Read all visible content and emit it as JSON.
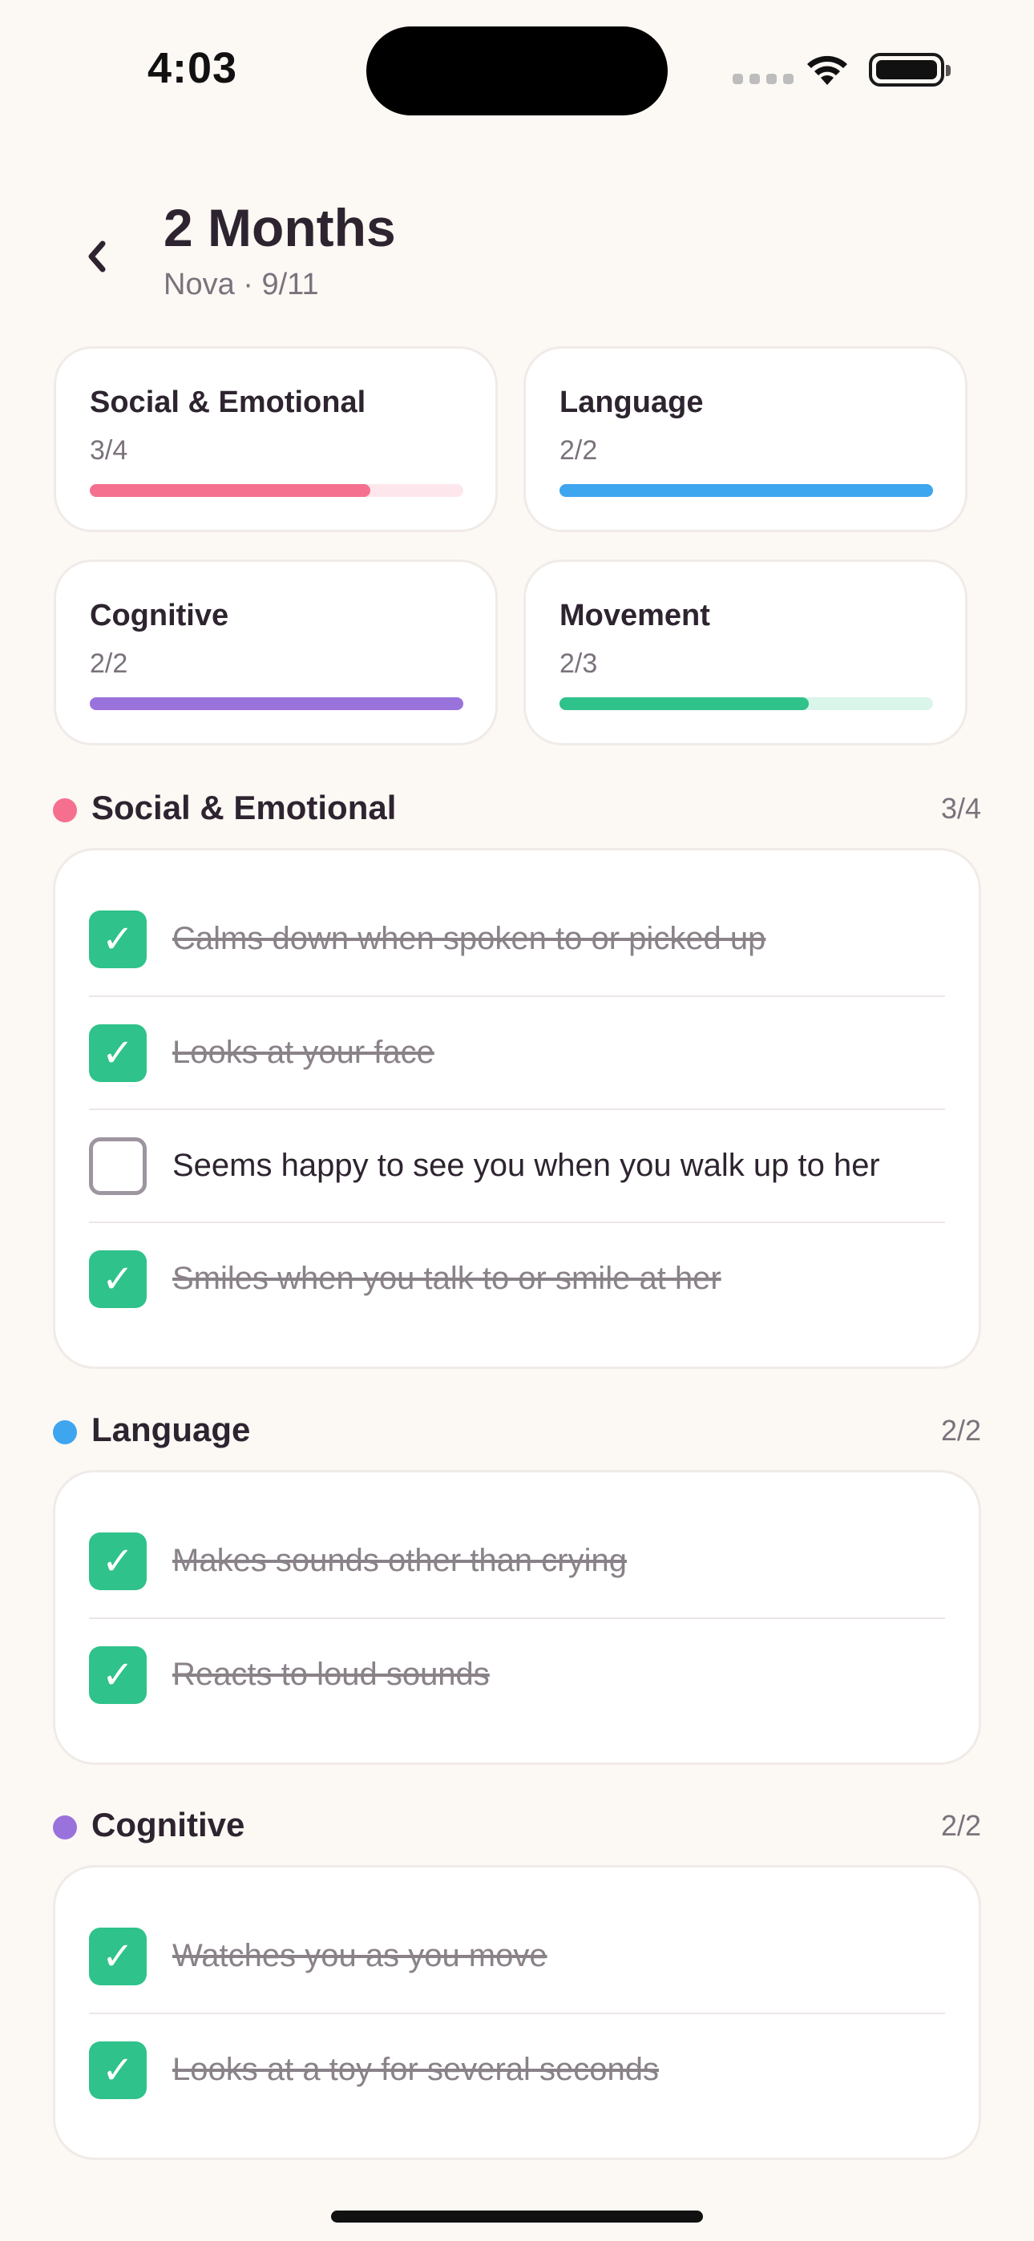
{
  "status_bar": {
    "time": "4:03"
  },
  "header": {
    "title": "2 Months",
    "subtitle": "Nova · 9/11"
  },
  "colors": {
    "social": "#f5708f",
    "social_track": "#fde6ec",
    "language": "#3ea5ef",
    "language_track": "#dcefff",
    "cognitive": "#9a72dc",
    "cognitive_track": "#ece4fa",
    "movement": "#2fc28a",
    "movement_track": "#daf5ea"
  },
  "summary": [
    {
      "title": "Social & Emotional",
      "count": "3/4",
      "progress": 0.75
    },
    {
      "title": "Language",
      "count": "2/2",
      "progress": 1.0
    },
    {
      "title": "Cognitive",
      "count": "2/2",
      "progress": 1.0
    },
    {
      "title": "Movement",
      "count": "2/3",
      "progress": 0.667
    }
  ],
  "sections": [
    {
      "title": "Social & Emotional",
      "count": "3/4",
      "items": [
        {
          "text": "Calms down when spoken to or picked up",
          "checked": true
        },
        {
          "text": "Looks at your face",
          "checked": true
        },
        {
          "text": "Seems happy to see you when you walk up to her",
          "checked": false
        },
        {
          "text": "Smiles when you talk to or smile at her",
          "checked": true
        }
      ]
    },
    {
      "title": "Language",
      "count": "2/2",
      "items": [
        {
          "text": "Makes sounds other than crying",
          "checked": true
        },
        {
          "text": "Reacts to loud sounds",
          "checked": true
        }
      ]
    },
    {
      "title": "Cognitive",
      "count": "2/2",
      "items": [
        {
          "text": "Watches you as you move",
          "checked": true
        },
        {
          "text": "Looks at a toy for several seconds",
          "checked": true
        }
      ]
    }
  ],
  "icons": {
    "back": "chevron-left-icon",
    "check": "checkmark-icon",
    "wifi": "wifi-icon",
    "battery": "battery-icon"
  }
}
